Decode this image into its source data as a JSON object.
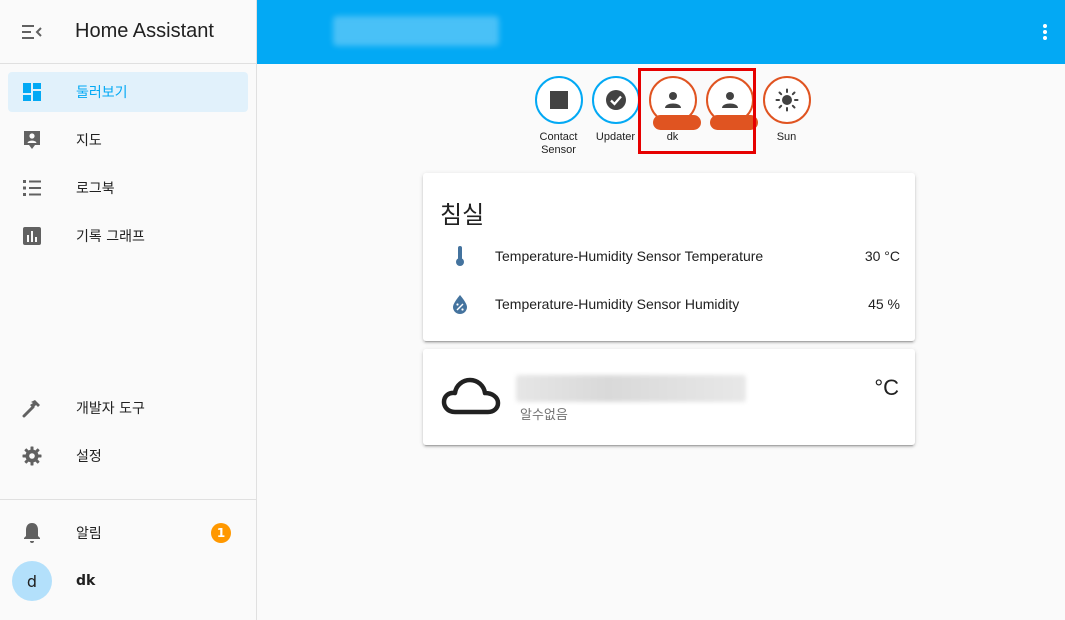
{
  "sidebar": {
    "title": "Home Assistant",
    "items": [
      {
        "label": "둘러보기",
        "icon": "dashboard-icon"
      },
      {
        "label": "지도",
        "icon": "map-account-icon"
      },
      {
        "label": "로그북",
        "icon": "logbook-list-icon"
      },
      {
        "label": "기록 그래프",
        "icon": "history-chart-icon"
      }
    ],
    "bottom_items": [
      {
        "label": "개발자 도구",
        "icon": "hammer-icon"
      },
      {
        "label": "설정",
        "icon": "gear-icon"
      }
    ],
    "notifications": {
      "label": "알림",
      "count": "1"
    },
    "user": {
      "initial": "d",
      "name": "dk"
    }
  },
  "badges": [
    {
      "label": "Contact Sensor",
      "icon": "stop-icon"
    },
    {
      "label": "Updater",
      "icon": "check-circle-icon"
    },
    {
      "label": "dk",
      "icon": "person-icon"
    },
    {
      "label": "",
      "icon": "person-icon"
    },
    {
      "label": "Sun",
      "icon": "sun-icon"
    }
  ],
  "room_card": {
    "title": "침실",
    "entities": [
      {
        "name": "Temperature-Humidity Sensor Temperature",
        "value": "30 °C",
        "icon": "thermometer-icon"
      },
      {
        "name": "Temperature-Humidity Sensor Humidity",
        "value": "45 %",
        "icon": "water-percent-icon"
      }
    ]
  },
  "weather_card": {
    "state": "알수없음",
    "temperature": "°C",
    "icon": "cloud-icon"
  },
  "colors": {
    "primary": "#03a9f4",
    "accent_badge": "#ff9800",
    "person_badge": "#e05421",
    "highlight": "#e60000"
  }
}
